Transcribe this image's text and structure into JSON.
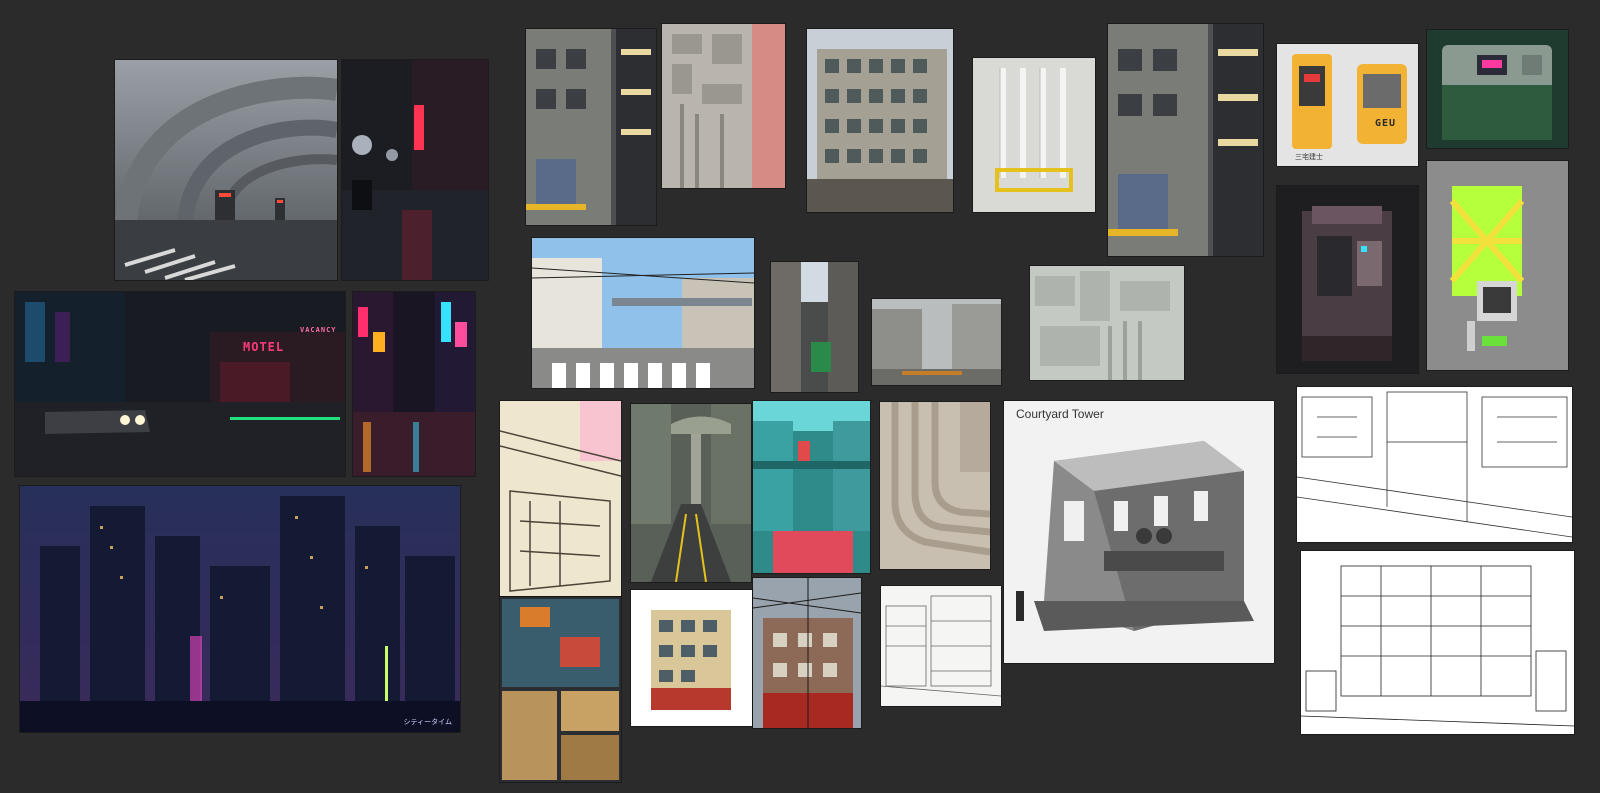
{
  "board": {
    "caption_courtyard": "Courtyard Tower",
    "motel_sign": "MOTEL",
    "vacancy_sign": "VACANCY",
    "city_signature_line1": "シティータイム",
    "city_signature_line2": "",
    "kiosk_logo_a": "GEU",
    "kiosk_logo_b": "三宅建士"
  },
  "colors": {
    "background": "#2b2b2b",
    "neon_pink": "#ff3a7a",
    "neon_cyan": "#36e0ff",
    "kiosk_yellow": "#f2b233",
    "kiosk_green": "#b6ff3b"
  }
}
